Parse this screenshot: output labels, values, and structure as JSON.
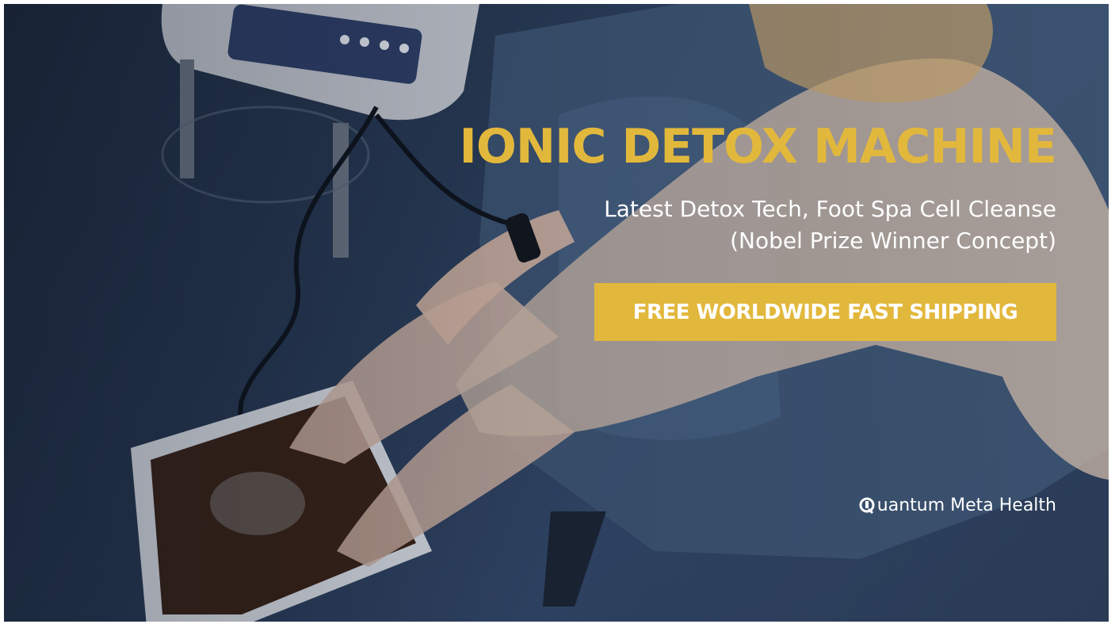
{
  "hero": {
    "headline": "IONIC DETOX MACHINE",
    "subheadline_line1": "Latest Detox Tech, Foot Spa Cell Cleanse",
    "subheadline_line2": "(Nobel Prize Winner Concept)",
    "cta_label": "FREE WORLDWIDE FAST SHIPPING"
  },
  "brand": {
    "logo_icon": "q-logo-icon",
    "name": "uantum Meta Health"
  },
  "colors": {
    "accent": "#e2b83c",
    "text": "#ffffff",
    "background_tint": "#27364f"
  }
}
